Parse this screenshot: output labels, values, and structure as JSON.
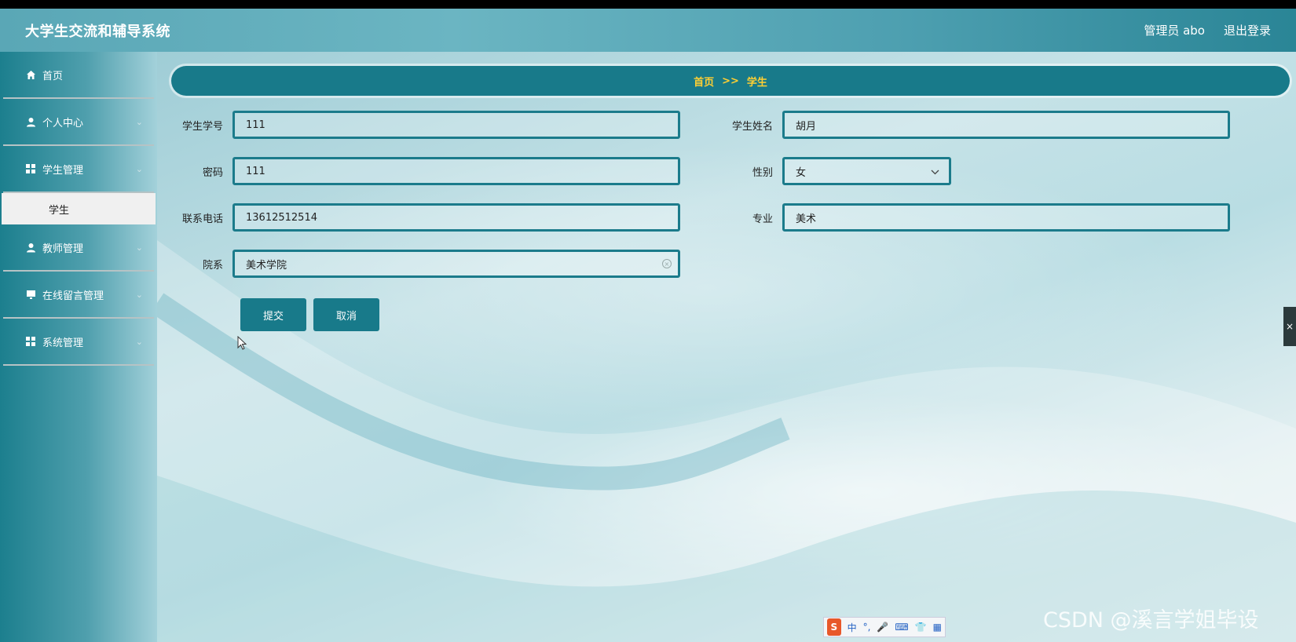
{
  "header": {
    "title": "大学生交流和辅导系统",
    "user_label": "管理员 abo",
    "logout_label": "退出登录"
  },
  "sidebar": {
    "items": [
      {
        "label": "首页",
        "icon": "home-icon"
      },
      {
        "label": "个人中心",
        "icon": "user-icon"
      },
      {
        "label": "学生管理",
        "icon": "grid-icon"
      },
      {
        "label": "教师管理",
        "icon": "user-icon"
      },
      {
        "label": "在线留言管理",
        "icon": "monitor-icon"
      },
      {
        "label": "系统管理",
        "icon": "grid-icon"
      }
    ],
    "subitem": "学生"
  },
  "breadcrumb": {
    "home": "首页",
    "separator": ">>",
    "current": "学生"
  },
  "form": {
    "student_id": {
      "label": "学生学号",
      "value": "111"
    },
    "student_name": {
      "label": "学生姓名",
      "value": "胡月"
    },
    "password": {
      "label": "密码",
      "value": "111"
    },
    "gender": {
      "label": "性别",
      "value": "女"
    },
    "phone": {
      "label": "联系电话",
      "value": "13612512514"
    },
    "major": {
      "label": "专业",
      "value": "美术"
    },
    "department": {
      "label": "院系",
      "value": "美术学院"
    },
    "submit_label": "提交",
    "cancel_label": "取消"
  },
  "ime": {
    "lang": "中"
  },
  "watermark": "CSDN @溪言学姐毕设",
  "colors": {
    "accent": "#187a8a",
    "breadcrumb_text": "#ffcf33"
  }
}
